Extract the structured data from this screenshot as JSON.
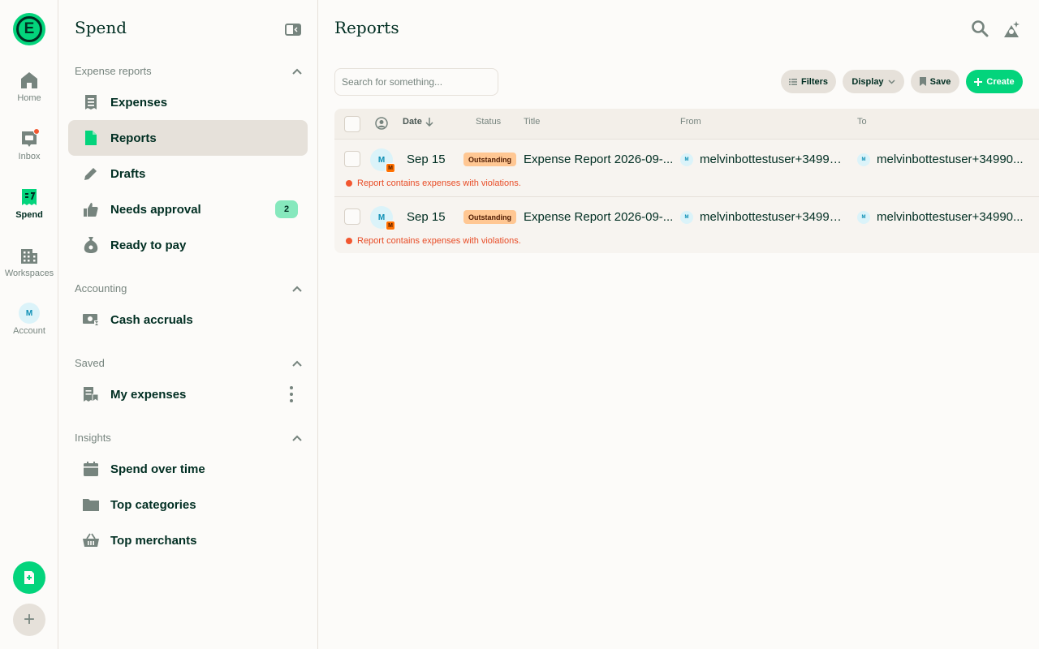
{
  "rail": {
    "logo_letter": "E",
    "items": [
      {
        "label": "Home",
        "icon": "home-icon"
      },
      {
        "label": "Inbox",
        "icon": "inbox-icon"
      },
      {
        "label": "Spend",
        "icon": "receipt-icon"
      },
      {
        "label": "Workspaces",
        "icon": "building-icon"
      },
      {
        "label": "Account",
        "avatar_letter": "M"
      }
    ],
    "gray_fab_symbol": "+"
  },
  "sidebar": {
    "title": "Spend",
    "sections": {
      "expense_reports": {
        "label": "Expense reports",
        "items": [
          {
            "label": "Expenses"
          },
          {
            "label": "Reports"
          },
          {
            "label": "Drafts"
          },
          {
            "label": "Needs approval",
            "badge": "2"
          },
          {
            "label": "Ready to pay"
          }
        ]
      },
      "accounting": {
        "label": "Accounting",
        "items": [
          {
            "label": "Cash accruals"
          }
        ]
      },
      "saved": {
        "label": "Saved",
        "items": [
          {
            "label": "My expenses"
          }
        ]
      },
      "insights": {
        "label": "Insights",
        "items": [
          {
            "label": "Spend over time"
          },
          {
            "label": "Top categories"
          },
          {
            "label": "Top merchants"
          }
        ]
      }
    }
  },
  "main": {
    "title": "Reports",
    "search_placeholder": "Search for something...",
    "buttons": {
      "filters": "Filters",
      "display": "Display",
      "save": "Save",
      "create": "Create"
    },
    "columns": {
      "date": "Date",
      "status": "Status",
      "title": "Title",
      "from": "From",
      "to": "To"
    },
    "rows": [
      {
        "avatar": "M",
        "avatar_sub": "M",
        "date": "Sep 15",
        "status": "Outstanding",
        "title": "Expense Report 2026-09-...",
        "from_avatar": "M",
        "from": "melvinbottestuser+34990...",
        "to_avatar": "M",
        "to": "melvinbottestuser+34990...",
        "violation": "Report contains expenses with violations."
      },
      {
        "avatar": "M",
        "avatar_sub": "M",
        "date": "Sep 15",
        "status": "Outstanding",
        "title": "Expense Report 2026-09-...",
        "from_avatar": "M",
        "from": "melvinbottestuser+34990...",
        "to_avatar": "M",
        "to": "melvinbottestuser+34990...",
        "violation": "Report contains expenses with violations."
      }
    ]
  },
  "colors": {
    "accent": "#03d47c",
    "text": "#002e22",
    "muted": "#76847e",
    "active_bg": "#e6e1da",
    "danger": "#f25730",
    "badge": "#86e8bd",
    "status_bg": "#ffc793"
  }
}
